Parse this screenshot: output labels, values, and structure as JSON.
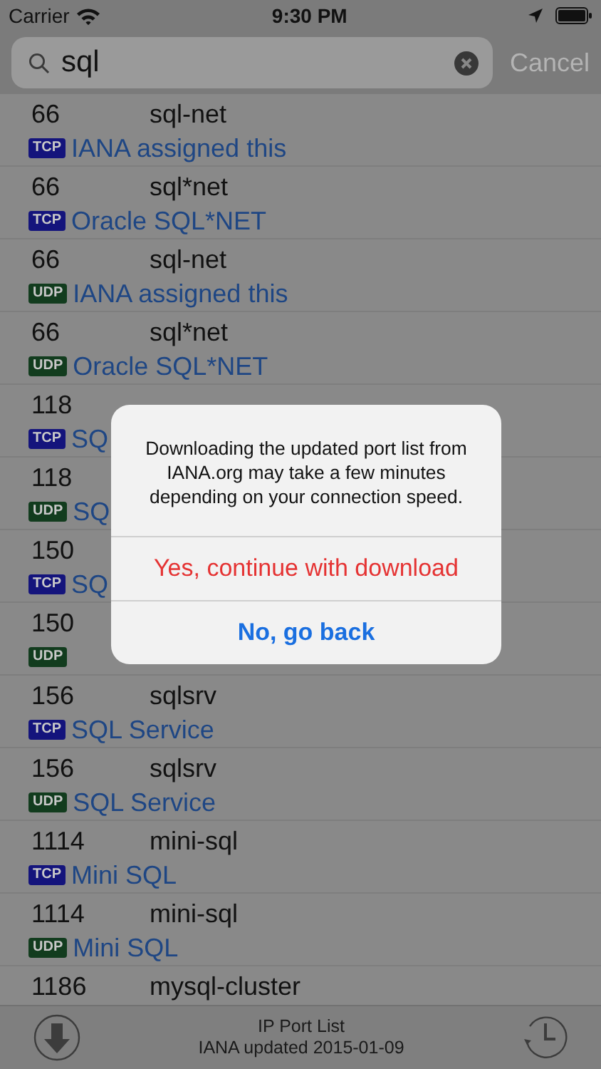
{
  "status_bar": {
    "carrier": "Carrier",
    "time": "9:30 PM"
  },
  "search": {
    "value": "sql",
    "cancel": {
      "label": "Cancel",
      "disabled": true
    }
  },
  "rows": [
    {
      "port": "66",
      "name": "sql-net",
      "protocol": "TCP",
      "color": "#14147c",
      "description": "IANA assigned this"
    },
    {
      "port": "66",
      "name": "sql*net",
      "protocol": "TCP",
      "color": "#14147c",
      "description": "Oracle SQL*NET"
    },
    {
      "port": "66",
      "name": "sql-net",
      "protocol": "UDP",
      "color": "#123c1e",
      "description": "IANA assigned this"
    },
    {
      "port": "66",
      "name": "sql*net",
      "protocol": "UDP",
      "color": "#123c1e",
      "description": "Oracle SQL*NET"
    },
    {
      "port": "118",
      "protocol": "TCP",
      "color": "#14147c",
      "description": "SQ"
    },
    {
      "port": "118",
      "protocol": "UDP",
      "color": "#123c1e",
      "description": "SQ"
    },
    {
      "port": "150",
      "protocol": "TCP",
      "color": "#14147c",
      "description": "SQ"
    },
    {
      "port": "150",
      "protocol": "UDP",
      "color": "#123c1e"
    },
    {
      "port": "156",
      "name": "sqlsrv",
      "protocol": "TCP",
      "color": "#14147c",
      "description": "SQL Service"
    },
    {
      "port": "156",
      "name": "sqlsrv",
      "protocol": "UDP",
      "color": "#123c1e",
      "description": "SQL Service"
    },
    {
      "port": "1114",
      "name": "mini-sql",
      "protocol": "TCP",
      "color": "#14147c",
      "description": "Mini SQL"
    },
    {
      "port": "1114",
      "name": "mini-sql",
      "protocol": "UDP",
      "color": "#123c1e",
      "description": "Mini SQL"
    },
    {
      "port": "1186",
      "name": "mysql-cluster"
    }
  ],
  "dialog": {
    "message": "Downloading the updated port list from IANA.org may take a few minutes depending on your connection speed.",
    "buttons": [
      {
        "label": "Yes, continue with download",
        "kind": "destructive"
      },
      {
        "label": "No, go back",
        "kind": "cancel"
      }
    ]
  },
  "toolbar": {
    "title": "IP Port List",
    "subtitle": "IANA updated 2015-01-09"
  }
}
